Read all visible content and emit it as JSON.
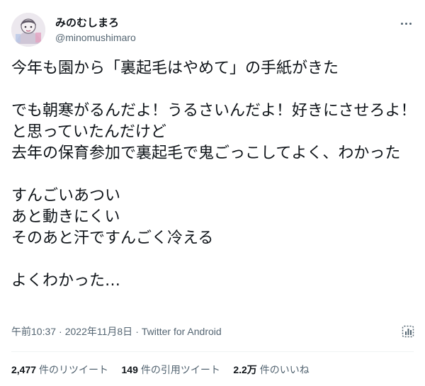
{
  "author": {
    "display_name": "みのむしまろ",
    "handle": "@minomushimaro",
    "avatar_icon": "avatar-illustration"
  },
  "tweet": {
    "text": "今年も園から「裏起毛はやめて」の手紙がきた\n\nでも朝寒がるんだよ！うるさいんだよ！好きにさせろよ！と思っていたんだけど\n去年の保育参加で裏起毛で鬼ごっこしてよく、わかった\n\nすんごいあつい\nあと動きにくい\nそのあと汗ですんごく冷える\n\nよくわかった…"
  },
  "meta": {
    "time": "午前10:37",
    "separator": "·",
    "date": "2022年11月8日",
    "source": "Twitter for Android"
  },
  "stats": {
    "retweets": {
      "count": "2,477",
      "label": "件のリツイート"
    },
    "quotes": {
      "count": "149",
      "label": "件の引用ツイート"
    },
    "likes": {
      "count": "2.2万",
      "label": "件のいいね"
    }
  },
  "colors": {
    "text": "#0f1419",
    "secondary": "#536471",
    "divider": "#eff3f4"
  }
}
